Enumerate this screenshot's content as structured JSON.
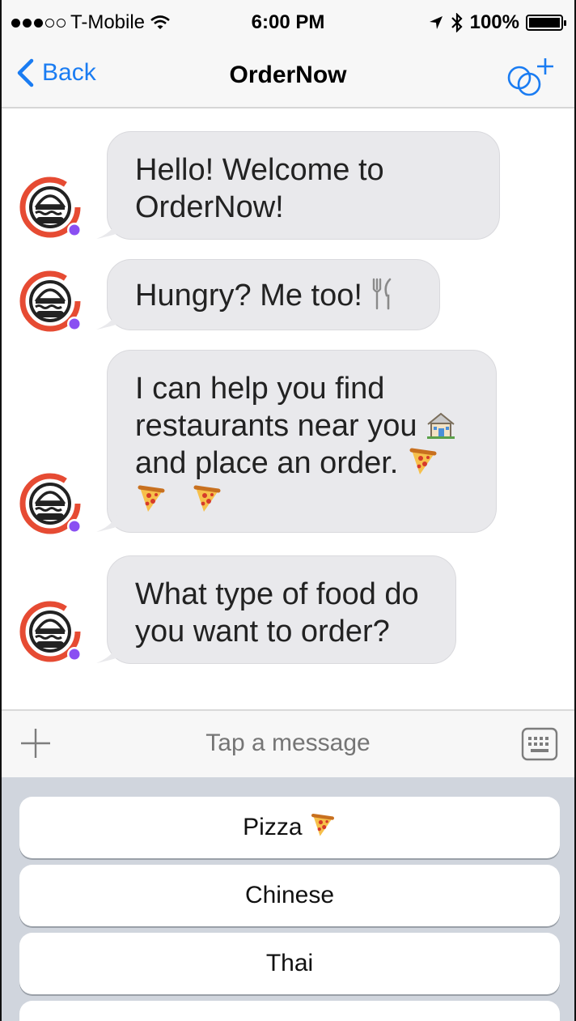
{
  "status_bar": {
    "carrier": "T-Mobile",
    "time": "6:00 PM",
    "battery": "100%"
  },
  "nav": {
    "back_label": "Back",
    "title": "OrderNow",
    "accent_color": "#1a7cf2"
  },
  "messages": [
    {
      "line1": "Hello! Welcome to",
      "line2": "OrderNow!"
    },
    {
      "text": "Hungry? Me too!"
    },
    {
      "line1": "I can help you find",
      "line2": "restaurants near you",
      "line3": "and place an order."
    },
    {
      "line1": "What type of food do",
      "line2": "you want to order?"
    }
  ],
  "input": {
    "placeholder": "Tap a message"
  },
  "quick_replies": [
    {
      "label": "Pizza"
    },
    {
      "label": "Chinese"
    },
    {
      "label": "Thai"
    }
  ],
  "icons": {
    "back": "chevron-left-icon",
    "group_add": "group-add-icon",
    "bot_avatar": "burger-logo-icon",
    "plus": "plus-icon",
    "keyboard": "keyboard-icon",
    "fork_knife": "fork-knife-icon",
    "house": "house-icon",
    "pizza": "pizza-slice-icon"
  }
}
